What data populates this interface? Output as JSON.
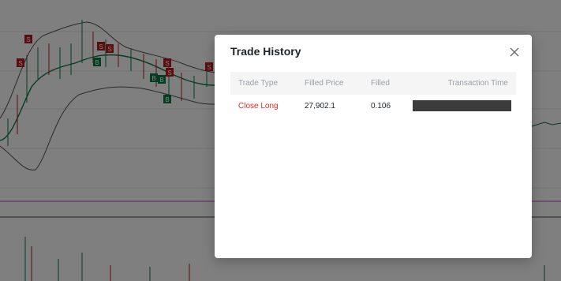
{
  "colors": {
    "accent_red": "#e0292f",
    "title": "#1e2329",
    "header_bg": "#f5f5f5",
    "chart_buy_marker": "#0a7a45",
    "chart_sell_marker": "#b71c1c",
    "redaction": "#3c3c3c"
  },
  "chart_markers": {
    "buy_label": "B",
    "sell_label": "S"
  },
  "modal": {
    "title": "Trade History",
    "close_icon": "close-icon"
  },
  "table": {
    "headers": {
      "trade_type": "Trade Type",
      "filled_price": "Filled Price",
      "filled": "Filled",
      "transaction_time": "Transaction Time"
    },
    "rows": [
      {
        "trade_type": "Close Long",
        "filled_price": "27,902.1",
        "filled": "0.106",
        "transaction_time": ""
      }
    ]
  }
}
